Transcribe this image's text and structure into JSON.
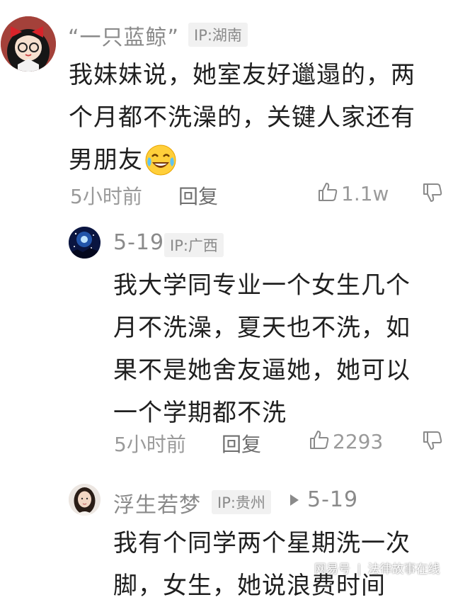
{
  "comments": [
    {
      "username": "“一只蓝鲸”",
      "ip": "IP:湖南",
      "lines": [
        "我妹妹说，她室友好邋遢的，两",
        "个月都不洗澡的，关键人家还有",
        "男朋友"
      ],
      "time": "5小时前",
      "reply": "回复",
      "likes": "1.1w"
    },
    {
      "username": "5-19",
      "ip": "IP:广西",
      "lines": [
        "我大学同专业一个女生几个",
        "月不洗澡，夏天也不洗，如",
        "果不是她舍友逼她，她可以",
        "一个学期都不洗"
      ],
      "time": "5小时前",
      "reply": "回复",
      "likes": "2293"
    },
    {
      "username": "浮生若梦",
      "ip": "IP:贵州",
      "reply_to": "5-19",
      "lines": [
        "我有个同学两个星期洗一次",
        "脚，女生，她说浪费时间"
      ]
    }
  ],
  "watermark": {
    "brand": "网易号",
    "separator": "|",
    "source": "法律故事在线"
  },
  "icons": [
    "like-icon",
    "dislike-icon",
    "laugh-cry-emoji",
    "reply-arrow-icon"
  ]
}
